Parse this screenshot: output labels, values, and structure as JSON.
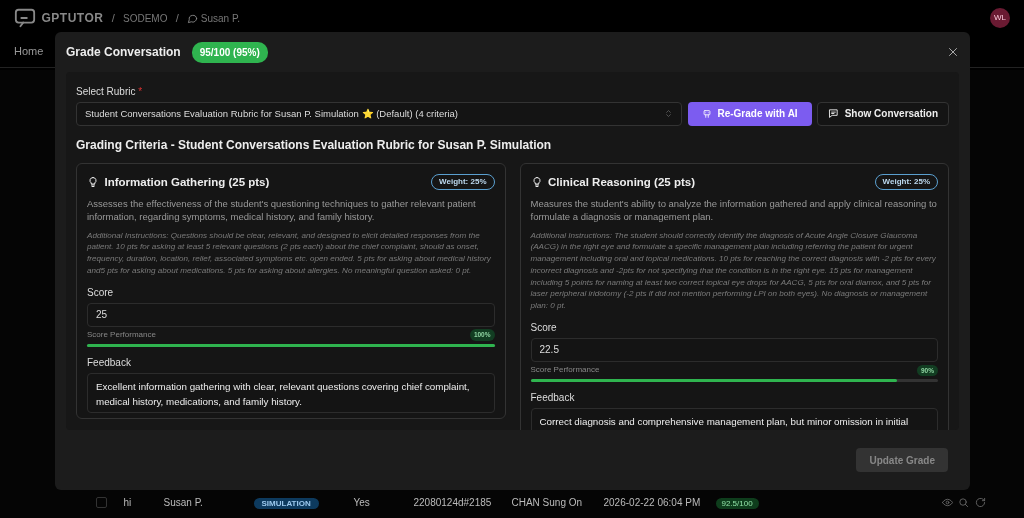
{
  "app": {
    "brand": "GPTUTOR",
    "separator": "/",
    "breadcrumbs": [
      {
        "label": "SODEMO",
        "kind": "text"
      },
      {
        "label": "Susan P.",
        "kind": "chat"
      }
    ],
    "nav": [
      "Home"
    ],
    "avatar": "WL"
  },
  "background_row": {
    "checked": false,
    "cells": [
      {
        "text": "hi",
        "kind": "text"
      },
      {
        "text": "Susan P.",
        "kind": "text"
      },
      {
        "text": "SIMULATION",
        "kind": "tag"
      },
      {
        "text": "Yes",
        "kind": "text"
      },
      {
        "text": "22080124d#2185",
        "kind": "text"
      },
      {
        "text": "CHAN Sung On",
        "kind": "text"
      },
      {
        "text": "2026-02-22 06:04 PM",
        "kind": "text"
      },
      {
        "text": "92.5/100",
        "kind": "score"
      }
    ]
  },
  "modal": {
    "title": "Grade Conversation",
    "score_badge": "95/100 (95%)",
    "rubric_label": "Select Rubric",
    "required_mark": "*",
    "rubric_value": "Student Conversations Evaluation Rubric for Susan P. Simulation ⭐ (Default) (4 criteria)",
    "regrade_button": "Re-Grade with AI",
    "show_button": "Show Conversation",
    "criteria_heading": "Grading Criteria - Student Conversations Evaluation Rubric for Susan P. Simulation",
    "criteria": [
      {
        "title": "Information Gathering (25 pts)",
        "weight": "Weight: 25%",
        "description": "Assesses the effectiveness of the student's questioning techniques to gather relevant patient information, regarding symptoms, medical history, and family history.",
        "instructions": "Additional Instructions: Questions should be clear, relevant, and designed to elicit detailed responses from the patient. 10 pts for asking at least 5 relevant questions (2 pts each) about the chief complaint, should as onset, frequency, duration, location, relief, associated symptoms etc. open ended. 5 pts for asking about medical history and5 pts for asking about medications. 5 pts for asking about allergies. No meaningful question asked: 0 pt.",
        "score_label": "Score",
        "score": "25",
        "performance_label": "Score Performance",
        "performance": "100%",
        "level": 1,
        "feedback_label": "Feedback",
        "feedback": "Excellent information gathering with clear, relevant questions covering chief complaint, medical history, medications, and family history."
      },
      {
        "title": "Clinical Reasoning (25 pts)",
        "weight": "Weight: 25%",
        "description": "Measures the student's ability to analyze the information gathered and apply clinical reasoning to formulate a diagnosis or management plan.",
        "instructions": "Additional Instructions: The student should correctly identify the diagnosis of Acute Angle Closure Glaucoma (AACG) in the right eye and formulate a specific management plan including referring the patient for urgent management including oral and topical medications. 10 pts for reaching the correct diagnosis with -2 pts for every incorrect diagnosis and -2pts for not specifying that the condition is in the right eye. 15 pts for management including 5 points for naming at least two correct topical eye drops for AACG, 5 pts for oral diamox, and 5 pts for laser peripheral iridotomy (-2 pts if did not mention performing LPI on both eyes). No diagnosis or management plan: 0 pt.",
        "score_label": "Score",
        "score": "22.5",
        "performance_label": "Score Performance",
        "performance": "90%",
        "level": 0.9,
        "feedback_label": "Feedback",
        "feedback": "Correct diagnosis and comprehensive management plan, but minor omission in initial"
      }
    ],
    "update_button": "Update Grade",
    "update_disabled": true
  }
}
